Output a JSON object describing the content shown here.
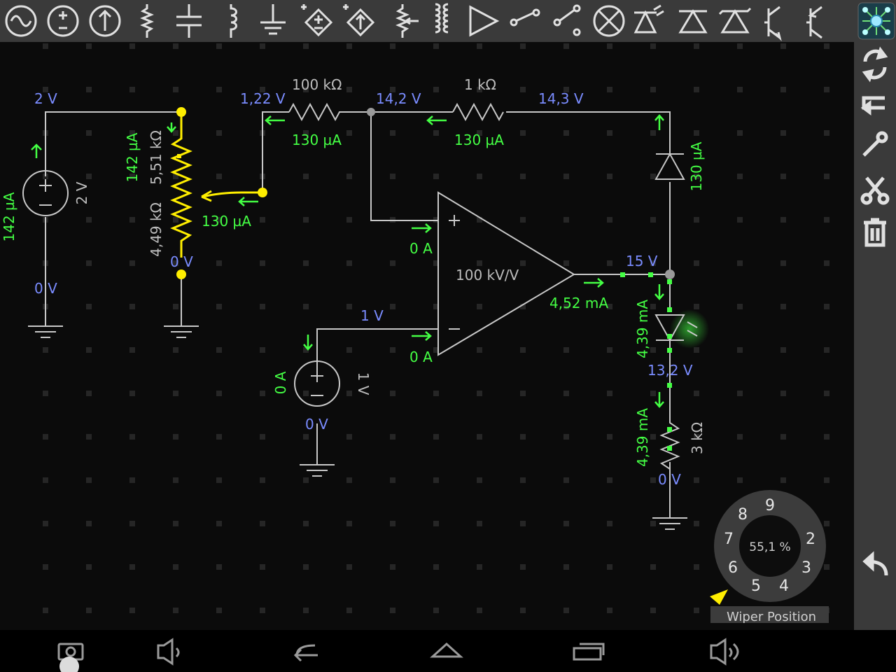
{
  "toolbar": {
    "items": [
      {
        "name": "ac-source-tool"
      },
      {
        "name": "dc-voltage-source-tool"
      },
      {
        "name": "current-source-tool"
      },
      {
        "name": "resistor-tool"
      },
      {
        "name": "capacitor-tool"
      },
      {
        "name": "inductor-tool"
      },
      {
        "name": "ground-tool"
      },
      {
        "name": "dependent-voltage-source-tool"
      },
      {
        "name": "dependent-current-source-tool"
      },
      {
        "name": "potentiometer-tool"
      },
      {
        "name": "transformer-tool"
      },
      {
        "name": "opamp-tool"
      },
      {
        "name": "switch-spst-tool"
      },
      {
        "name": "switch-spdt-tool"
      },
      {
        "name": "lamp-tool"
      },
      {
        "name": "led-tool"
      },
      {
        "name": "diode-tool"
      },
      {
        "name": "zener-diode-tool"
      },
      {
        "name": "npn-transistor-tool"
      },
      {
        "name": "pnp-transistor-tool"
      },
      {
        "name": "app-logo"
      }
    ]
  },
  "sidebar": {
    "items": [
      {
        "name": "rotate-button"
      },
      {
        "name": "mirror-button"
      },
      {
        "name": "properties-button"
      },
      {
        "name": "cut-button"
      },
      {
        "name": "delete-button"
      },
      {
        "name": "undo-button"
      }
    ]
  },
  "navbar": {
    "items": [
      {
        "name": "screenshot-button"
      },
      {
        "name": "volume-down-button"
      },
      {
        "name": "back-button"
      },
      {
        "name": "home-button"
      },
      {
        "name": "recent-apps-button"
      },
      {
        "name": "volume-up-button"
      }
    ]
  },
  "colors": {
    "wire": "#c8c8c8",
    "voltage": "#7a8cff",
    "current": "#44ff44",
    "selected": "#ffee00",
    "value": "#bdbdbd",
    "grid": "#2a2a2a"
  },
  "circuit": {
    "node_voltages": {
      "source_top": "2 V",
      "source_bottom": "0 V",
      "pot_bottom": "0 V",
      "wiper_node": "1,22 V",
      "opamp_plus": "14,2 V",
      "r1k_right": "14,3 V",
      "opamp_out": "15 V",
      "neg_input": "1 V",
      "src2_bottom": "0 V",
      "led_cathode": "13,2 V",
      "r3k_bottom": "0 V"
    },
    "currents": {
      "source_current": "142 µA",
      "pot_current": "142 µA",
      "wiper_current": "130 µA",
      "r100k_current": "130 µA",
      "r1k_current": "130 µA",
      "diode_current": "130 µA",
      "opamp_plus_current": "0 A",
      "opamp_minus_current": "0 A",
      "opamp_out_current": "4,52 mA",
      "src2_current": "0 A",
      "led_current": "4,39 mA",
      "r3k_current": "4,39 mA"
    },
    "component_values": {
      "source_value": "2 V",
      "pot_upper": "5,51 kΩ",
      "pot_lower": "4,49 kΩ",
      "r100k": "100 kΩ",
      "r1k": "1 kΩ",
      "opamp_gain": "100 kV/V",
      "src2_value": "1 V",
      "r3k": "3 kΩ"
    }
  },
  "wiper_dial": {
    "value": "55,1 %",
    "numbers": [
      "9",
      "8",
      "7",
      "6",
      "5",
      "4",
      "3",
      "2"
    ],
    "tooltip": "Wiper Position",
    "level": 0.551
  }
}
